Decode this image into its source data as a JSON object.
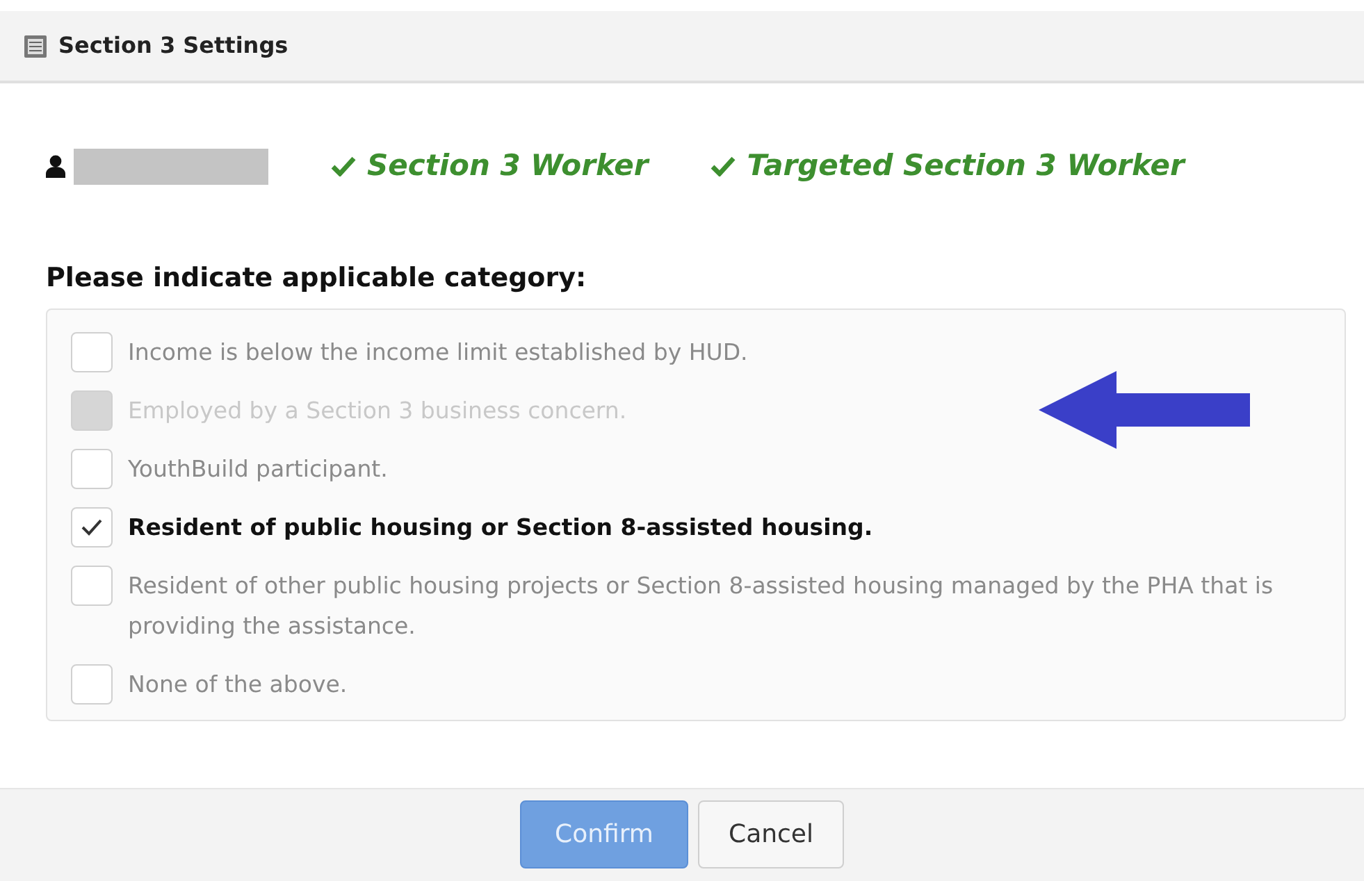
{
  "window": {
    "title": "Section 3 Settings"
  },
  "worker": {
    "badges": [
      "Section 3 Worker",
      "Targeted Section 3 Worker"
    ]
  },
  "heading": "Please indicate applicable category:",
  "options": [
    {
      "label": "Income is below the income limit established by HUD.",
      "checked": false,
      "disabled": false
    },
    {
      "label": "Employed by a Section 3 business concern.",
      "checked": false,
      "disabled": true
    },
    {
      "label": "YouthBuild participant.",
      "checked": false,
      "disabled": false
    },
    {
      "label": "Resident of public housing or Section 8-assisted housing.",
      "checked": true,
      "disabled": false
    },
    {
      "label": "Resident of other public housing projects or Section 8-assisted housing managed by the PHA that is providing the assistance.",
      "checked": false,
      "disabled": false
    },
    {
      "label": "None of the above.",
      "checked": false,
      "disabled": false
    }
  ],
  "buttons": [
    {
      "label": "Confirm",
      "kind": "primary"
    },
    {
      "label": "Cancel",
      "kind": "secondary"
    }
  ]
}
